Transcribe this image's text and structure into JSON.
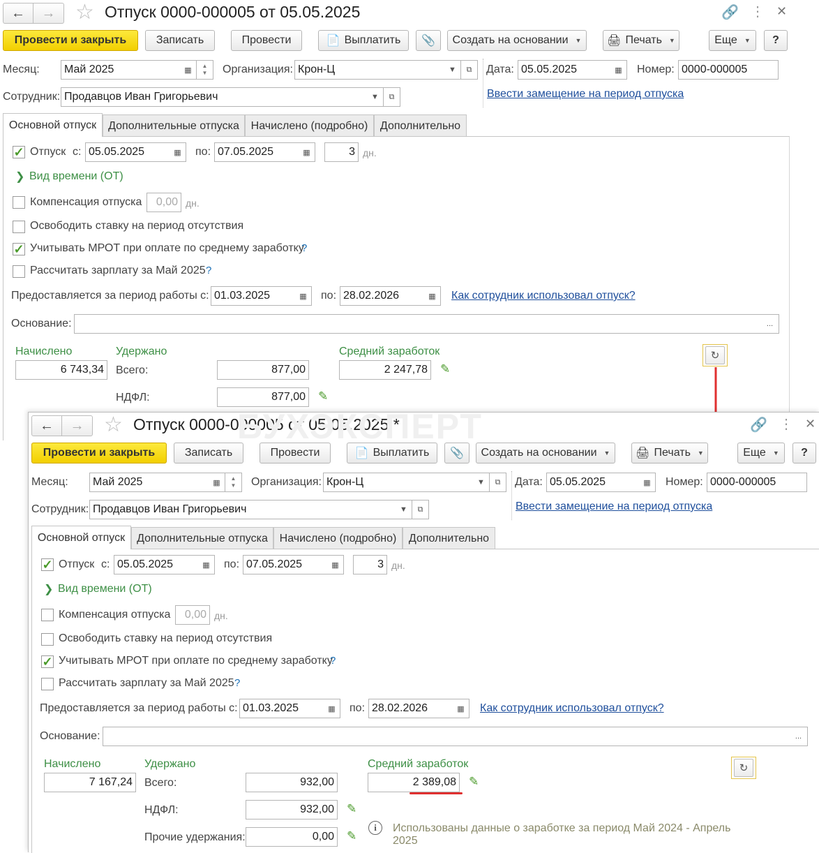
{
  "window1": {
    "title": "Отпуск 0000-000005 от 05.05.2025",
    "toolbar": {
      "post_close": "Провести и закрыть",
      "save": "Записать",
      "post": "Провести",
      "pay": "Выплатить",
      "create_based": "Создать на основании",
      "print": "Печать",
      "more": "Еще",
      "help": "?"
    },
    "header": {
      "month_label": "Месяц:",
      "month": "Май 2025",
      "org_label": "Организация:",
      "org": "Крон-Ц",
      "date_label": "Дата:",
      "date": "05.05.2025",
      "number_label": "Номер:",
      "number": "0000-000005",
      "employee_label": "Сотрудник:",
      "employee": "Продавцов Иван Григорьевич",
      "substitute_link": "Ввести замещение на период отпуска"
    },
    "tabs": [
      "Основной отпуск",
      "Дополнительные отпуска",
      "Начислено (подробно)",
      "Дополнительно"
    ],
    "main": {
      "vacation_label": "Отпуск",
      "from_label": "с:",
      "from": "05.05.2025",
      "to_label": "по:",
      "to": "07.05.2025",
      "days": "3",
      "days_unit": "дн.",
      "time_type": "Вид времени (ОТ)",
      "compensation_label": "Компенсация отпуска",
      "compensation_value": "0,00",
      "compensation_unit": "дн.",
      "release_rate": "Освободить ставку на период отсутствия",
      "mrot": "Учитывать МРОТ при оплате по среднему заработку",
      "calc_salary": "Рассчитать зарплату за Май 2025",
      "hint_mark": "?",
      "period_label": "Предоставляется за период работы с:",
      "period_from": "01.03.2025",
      "period_to_label": "по:",
      "period_to": "28.02.2026",
      "usage_link": "Как сотрудник использовал отпуск?",
      "basis_label": "Основание:",
      "basis": "",
      "basis_btn": "...",
      "accrued_label": "Начислено",
      "accrued": "6 743,34",
      "withheld_label": "Удержано",
      "total_label": "Всего:",
      "total": "877,00",
      "ndfl_label": "НДФЛ:",
      "ndfl": "877,00",
      "avg_label": "Средний заработок",
      "avg": "2 247,78"
    }
  },
  "window2": {
    "title": "Отпуск 0000-000005 от 05.05.2025 *",
    "toolbar": {
      "post_close": "Провести и закрыть",
      "save": "Записать",
      "post": "Провести",
      "pay": "Выплатить",
      "create_based": "Создать на основании",
      "print": "Печать",
      "more": "Еще",
      "help": "?"
    },
    "header": {
      "month_label": "Месяц:",
      "month": "Май 2025",
      "org_label": "Организация:",
      "org": "Крон-Ц",
      "date_label": "Дата:",
      "date": "05.05.2025",
      "number_label": "Номер:",
      "number": "0000-000005",
      "employee_label": "Сотрудник:",
      "employee": "Продавцов Иван Григорьевич",
      "substitute_link": "Ввести замещение на период отпуска"
    },
    "tabs": [
      "Основной отпуск",
      "Дополнительные отпуска",
      "Начислено (подробно)",
      "Дополнительно"
    ],
    "main": {
      "vacation_label": "Отпуск",
      "from_label": "с:",
      "from": "05.05.2025",
      "to_label": "по:",
      "to": "07.05.2025",
      "days": "3",
      "days_unit": "дн.",
      "time_type": "Вид времени (ОТ)",
      "compensation_label": "Компенсация отпуска",
      "compensation_value": "0,00",
      "compensation_unit": "дн.",
      "release_rate": "Освободить ставку на период отсутствия",
      "mrot": "Учитывать МРОТ при оплате по среднему заработку",
      "calc_salary": "Рассчитать зарплату за Май 2025",
      "hint_mark": "?",
      "period_label": "Предоставляется за период работы с:",
      "period_from": "01.03.2025",
      "period_to_label": "по:",
      "period_to": "28.02.2026",
      "usage_link": "Как сотрудник использовал отпуск?",
      "basis_label": "Основание:",
      "basis": "",
      "basis_btn": "...",
      "accrued_label": "Начислено",
      "accrued": "7 167,24",
      "withheld_label": "Удержано",
      "total_label": "Всего:",
      "total": "932,00",
      "ndfl_label": "НДФЛ:",
      "ndfl": "932,00",
      "other_label": "Прочие удержания:",
      "other": "0,00",
      "avg_label": "Средний заработок",
      "avg": "2 389,08",
      "info": "Использованы данные о заработке за период Май 2024 - Апрель 2025"
    }
  },
  "watermark": "БУХЭКСПЕРТ",
  "colors": {
    "primary_button": "#f5d50a",
    "label_green": "#3d8f45",
    "link": "#1f4f9c",
    "highlight_red": "#e03030",
    "accent_frame": "#e3c44a"
  },
  "icons": [
    "back-arrow-icon",
    "forward-arrow-icon",
    "star-icon",
    "link-icon",
    "more-icon",
    "close-icon",
    "paperclip-icon",
    "printer-icon",
    "calendar-icon",
    "refresh-icon",
    "pencil-icon",
    "info-icon",
    "checkmark-icon"
  ]
}
